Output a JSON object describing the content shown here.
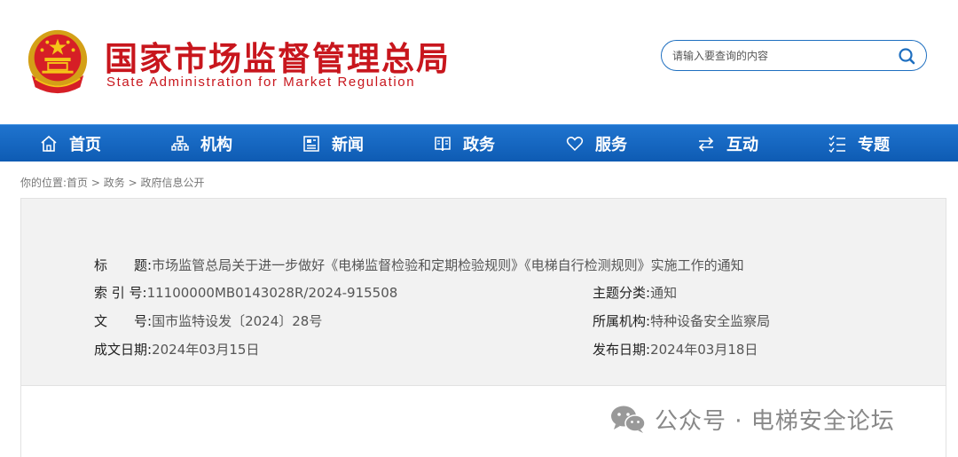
{
  "header": {
    "title_cn": "国家市场监督管理总局",
    "title_en": "State Administration for Market Regulation",
    "search_placeholder": "请输入要查询的内容"
  },
  "nav": [
    {
      "label": "首页",
      "icon": "home-icon"
    },
    {
      "label": "机构",
      "icon": "org-chart-icon"
    },
    {
      "label": "新闻",
      "icon": "newspaper-icon"
    },
    {
      "label": "政务",
      "icon": "book-icon"
    },
    {
      "label": "服务",
      "icon": "heart-icon"
    },
    {
      "label": "互动",
      "icon": "exchange-arrows-icon"
    },
    {
      "label": "专题",
      "icon": "list-icon"
    }
  ],
  "breadcrumb": {
    "prefix": "你的位置:",
    "home": "首页",
    "sep": " > ",
    "section": "政务",
    "page": "政府信息公开"
  },
  "info": {
    "title_label": "标　　题:",
    "title_value": "市场监管总局关于进一步做好《电梯监督检验和定期检验规则》《电梯自行检测规则》实施工作的通知",
    "index_label": "索 引 号:",
    "index_value": "11100000MB0143028R/2024-915508",
    "topic_label": "主题分类:",
    "topic_value": "通知",
    "docno_label": "文　　号:",
    "docno_value": "国市监特设发〔2024〕28号",
    "org_label": "所属机构:",
    "org_value": "特种设备安全监察局",
    "created_label": "成文日期:",
    "created_value": "2024年03月15日",
    "published_label": "发布日期:",
    "published_value": "2024年03月18日"
  },
  "watermark": {
    "text": "公众号 · 电梯安全论坛",
    "icon": "wechat-icon"
  },
  "colors": {
    "brand_red": "#c8161d",
    "nav_blue": "#1266c2",
    "search_border": "#1e6fc0"
  }
}
